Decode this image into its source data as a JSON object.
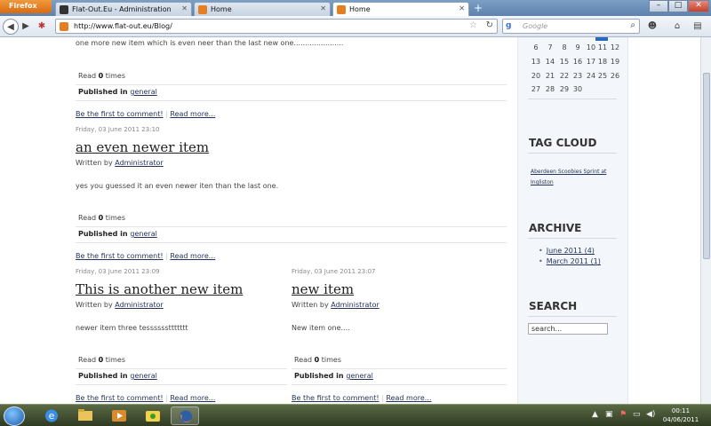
{
  "browser": {
    "menu_button": "Firefox",
    "tabs": [
      {
        "label": "Flat-Out.Eu - Administration"
      },
      {
        "label": "Home"
      },
      {
        "label": "Home"
      }
    ],
    "new_tab": "+",
    "url": "http://www.flat-out.eu/Blog/",
    "search_provider": "g",
    "search_placeholder": "Google"
  },
  "posts": {
    "top_snippet": "one more new item which is even neer than the last new one......................",
    "top": {
      "hits_label": "Read",
      "hits": "0",
      "hits_suffix": "times",
      "published_label": "Published in",
      "category": "general",
      "comment_link": "Be the first to comment!",
      "read_more": "Read more..."
    },
    "p1": {
      "date": "Friday, 03 June 2011 23:10",
      "title": "an even newer item",
      "written_label": "Written by",
      "author": "Administrator",
      "body": "yes you guessed it an even newer iten than the last one.",
      "hits_label": "Read",
      "hits": "0",
      "hits_suffix": "times",
      "published_label": "Published in",
      "category": "general",
      "comment_link": "Be the first to comment!",
      "read_more": "Read more..."
    },
    "p2": {
      "date": "Friday, 03 June 2011 23:09",
      "title": "This is another new item",
      "written_label": "Written by",
      "author": "Administrator",
      "body": "newer item three tessssssttttttt",
      "hits_label": "Read",
      "hits": "0",
      "hits_suffix": "times",
      "published_label": "Published in",
      "category": "general",
      "comment_link": "Be the first to comment!",
      "read_more": "Read more..."
    },
    "p3": {
      "date": "Friday, 03 June 2011 23:07",
      "title": "new item",
      "written_label": "Written by",
      "author": "Administrator",
      "body": "New item one....",
      "hits_label": "Read",
      "hits": "0",
      "hits_suffix": "times",
      "published_label": "Published in",
      "category": "general",
      "comment_link": "Be the first to comment!",
      "read_more": "Read more..."
    }
  },
  "sidebar": {
    "calendar_rows": [
      [
        "6",
        "7",
        "8",
        "9",
        "10",
        "11",
        "12"
      ],
      [
        "13",
        "14",
        "15",
        "16",
        "17",
        "18",
        "19"
      ],
      [
        "20",
        "21",
        "22",
        "23",
        "24",
        "25",
        "26"
      ],
      [
        "27",
        "28",
        "29",
        "30"
      ]
    ],
    "tag_cloud_title": "TAG CLOUD",
    "tag": "Aberdeen Scoobies Sprint at Ingliston",
    "archive_title": "ARCHIVE",
    "archive": [
      "June 2011 (4)",
      "March 2011 (1)"
    ],
    "search_title": "SEARCH",
    "search_placeholder": "search..."
  },
  "taskbar": {
    "time": "00:11",
    "date": "04/06/2011"
  },
  "colors": {
    "link": "#24345a",
    "firefox_orange": "#e57f22"
  }
}
